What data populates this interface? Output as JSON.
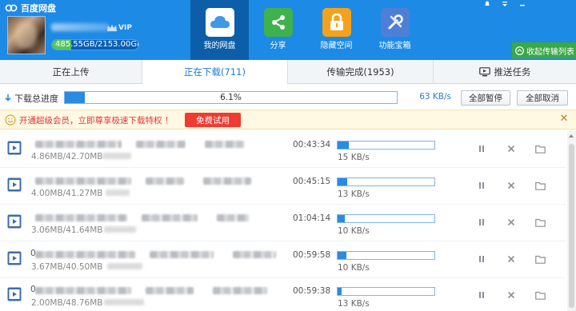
{
  "app": {
    "title": "百度网盘"
  },
  "account": {
    "vip_label": "VIP",
    "quota_text": "485.55GB/2153.00GB",
    "quota_fraction": 0.2255
  },
  "nav": [
    {
      "label": "我的网盘",
      "icon": "cloud-icon",
      "active": true
    },
    {
      "label": "分享",
      "icon": "share-icon",
      "active": false
    },
    {
      "label": "隐藏空间",
      "icon": "lock-icon",
      "active": false
    },
    {
      "label": "功能宝箱",
      "icon": "toolbox-icon",
      "active": false
    }
  ],
  "window": {
    "icons": [
      "bell-icon",
      "dropdown-icon",
      "minimize-icon"
    ]
  },
  "collect_label": "收起传输列表",
  "tabs": [
    {
      "label": "正在上传",
      "active": false
    },
    {
      "label": "正在下载(711)",
      "active": true
    },
    {
      "label": "传输完成(1953)",
      "active": false
    },
    {
      "label": "推送任务",
      "active": false,
      "icon": "monitor-icon"
    }
  ],
  "summary": {
    "label": "下载总进度",
    "percent_text": "6.1%",
    "fraction": 0.061,
    "speed": "63 KB/s",
    "pause_all": "全部暂停",
    "cancel_all": "全部取消"
  },
  "promo": {
    "text": "开通超级会员，立即尊享极速下载特权 ！",
    "button": "免费试用"
  },
  "downloads": [
    {
      "name_lead": "",
      "size": "4.86MB/42.70MB",
      "time": "00:43:34",
      "progress": 0.114,
      "speed": "15 KB/s"
    },
    {
      "name_lead": "",
      "size": "4.00MB/41.27MB",
      "time": "00:45:15",
      "progress": 0.097,
      "speed": "13 KB/s"
    },
    {
      "name_lead": "",
      "size": "3.06MB/41.64MB",
      "time": "01:04:14",
      "progress": 0.073,
      "speed": "10 KB/s"
    },
    {
      "name_lead": "0",
      "size": "3.67MB/40.50MB",
      "time": "00:59:58",
      "progress": 0.091,
      "speed": "10 KB/s"
    },
    {
      "name_lead": "0",
      "size": "2.00MB/48.76MB",
      "time": "00:59:38",
      "progress": 0.041,
      "speed": "13 KB/s"
    }
  ]
}
